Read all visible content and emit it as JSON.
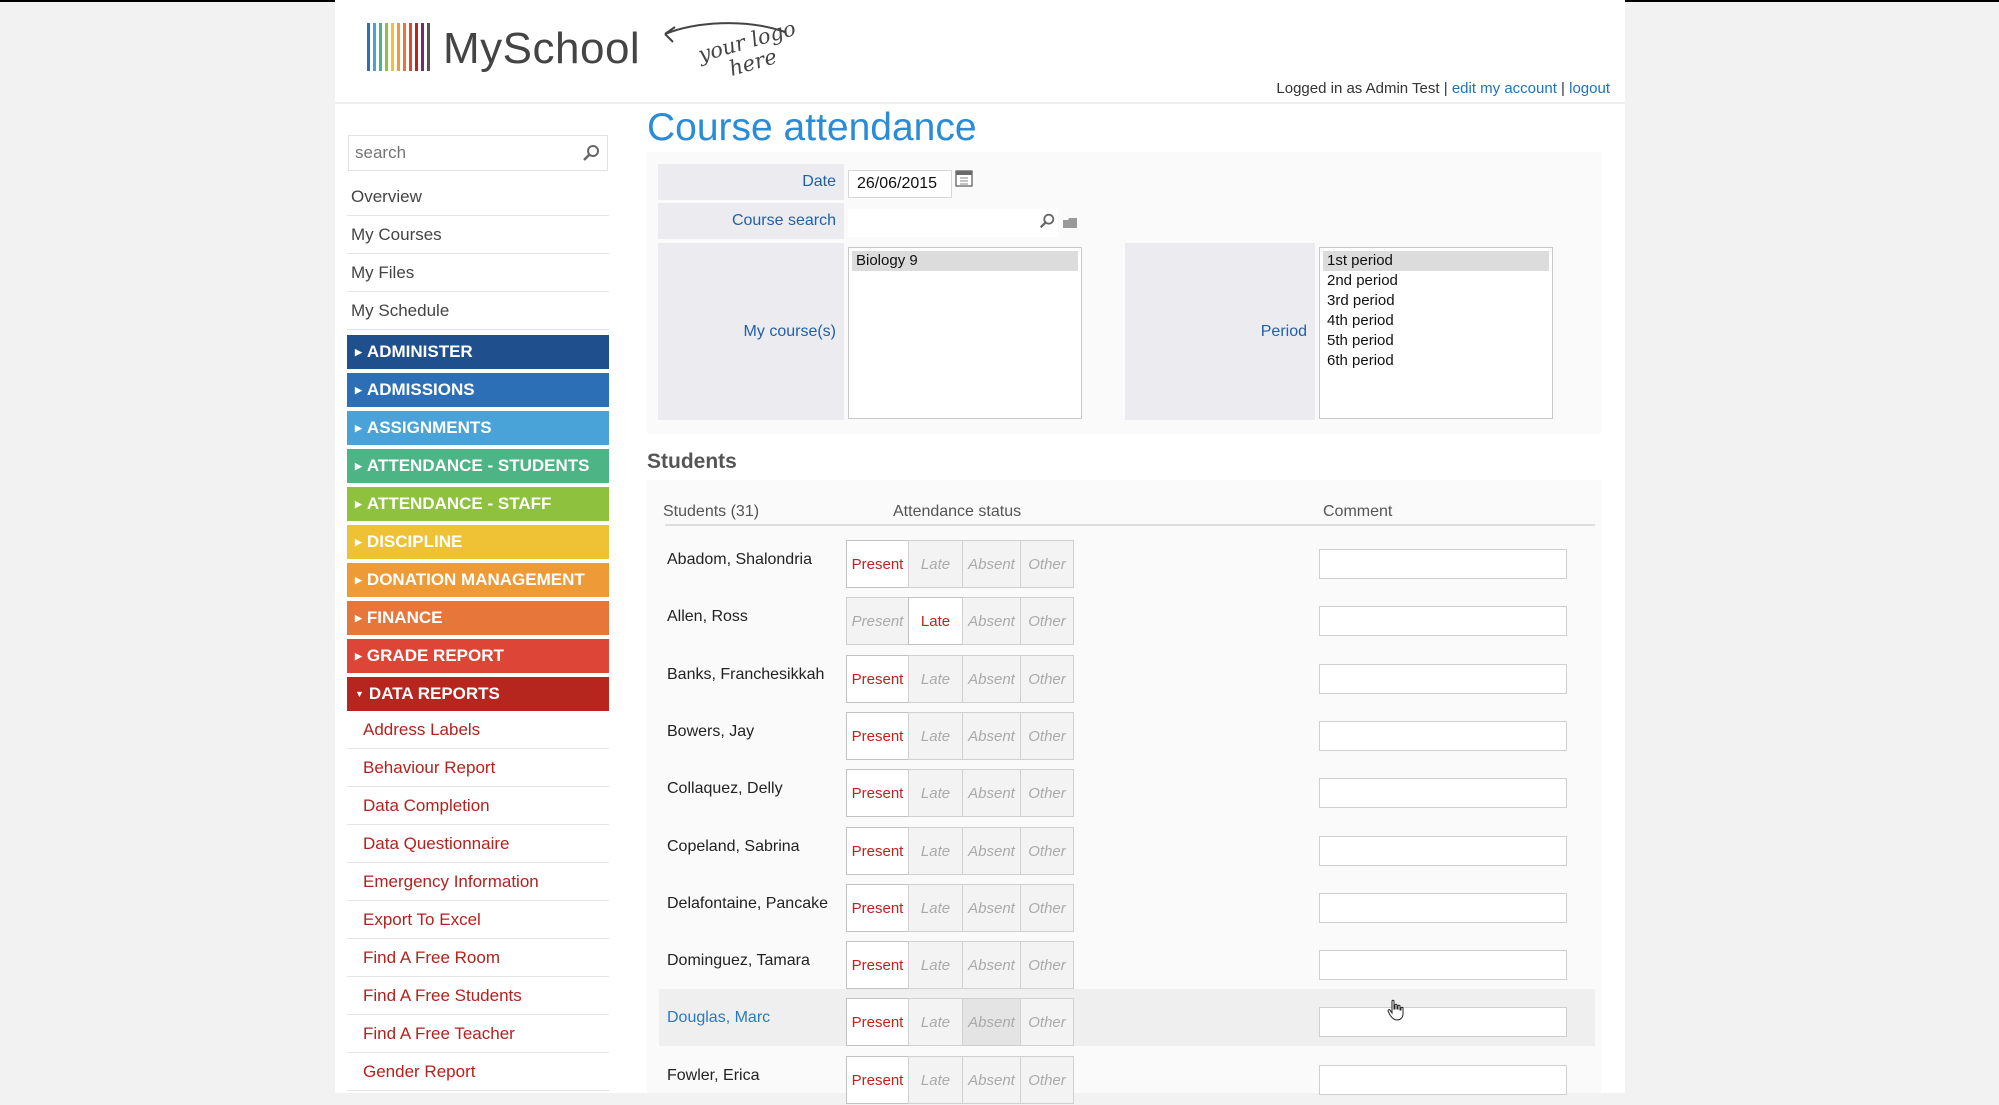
{
  "header": {
    "logo_text": "MySchool",
    "logo_note": "your logo here",
    "logged_in_text": "Logged in as Admin Test",
    "separator": "|",
    "edit_account": "edit my account",
    "logout": "logout"
  },
  "sidebar": {
    "search_placeholder": "search",
    "links": [
      "Overview",
      "My Courses",
      "My Files",
      "My Schedule"
    ],
    "sections": [
      {
        "label": "ADMINISTER",
        "color": "#1f4f8c"
      },
      {
        "label": "ADMISSIONS",
        "color": "#2c6fb7"
      },
      {
        "label": "ASSIGNMENTS",
        "color": "#4aa3d8"
      },
      {
        "label": "ATTENDANCE - STUDENTS",
        "color": "#4db486"
      },
      {
        "label": "ATTENDANCE - STAFF",
        "color": "#8ec13d"
      },
      {
        "label": "DISCIPLINE",
        "color": "#eec234"
      },
      {
        "label": "DONATION MANAGEMENT",
        "color": "#ee9a37"
      },
      {
        "label": "FINANCE",
        "color": "#e7763a"
      },
      {
        "label": "GRADE REPORT",
        "color": "#dd4636"
      },
      {
        "label": "DATA REPORTS",
        "color": "#b6261f",
        "expanded": true
      }
    ],
    "data_reports": [
      "Address Labels",
      "Behaviour Report",
      "Data Completion",
      "Data Questionnaire",
      "Emergency Information",
      "Export To Excel",
      "Find A Free Room",
      "Find A Free Students",
      "Find A Free Teacher",
      "Gender Report"
    ]
  },
  "main": {
    "title": "Course attendance",
    "date_label": "Date",
    "date_value": "26/06/2015",
    "course_search_label": "Course search",
    "my_courses_label": "My course(s)",
    "courses": [
      "Biology 9"
    ],
    "selected_course": "Biology 9",
    "period_label": "Period",
    "periods": [
      "1st period",
      "2nd period",
      "3rd period",
      "4th period",
      "5th period",
      "6th period"
    ],
    "selected_period": "1st period",
    "students_heading": "Students",
    "columns": {
      "students": "Students (31)",
      "status": "Attendance status",
      "comment": "Comment"
    },
    "status_options": [
      "Present",
      "Late",
      "Absent",
      "Other"
    ],
    "students": [
      {
        "name": "Abadom, Shalondria",
        "status": "Present"
      },
      {
        "name": "Allen, Ross",
        "status": "Late"
      },
      {
        "name": "Banks, Franchesikkah",
        "status": "Present"
      },
      {
        "name": "Bowers, Jay",
        "status": "Present"
      },
      {
        "name": "Collaquez, Delly",
        "status": "Present"
      },
      {
        "name": "Copeland, Sabrina",
        "status": "Present"
      },
      {
        "name": "Delafontaine, Pancake",
        "status": "Present"
      },
      {
        "name": "Dominguez, Tamara",
        "status": "Present"
      },
      {
        "name": "Douglas, Marc",
        "status": "Present",
        "highlighted": true,
        "hover": "Absent"
      },
      {
        "name": "Fowler, Erica",
        "status": "Present"
      }
    ]
  },
  "colors": {
    "accent_blue": "#2a8bd7",
    "link_blue": "#1e73be",
    "present_red": "#c4211c"
  }
}
